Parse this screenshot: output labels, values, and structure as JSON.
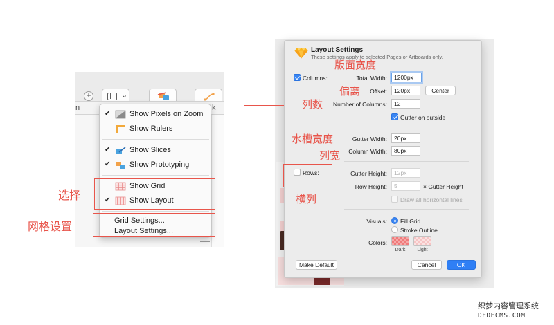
{
  "view_menu": {
    "items": [
      {
        "label": "Show Pixels on Zoom",
        "checked": true,
        "icon": "pixel-zoom-icon"
      },
      {
        "label": "Show Rulers",
        "checked": false,
        "icon": "ruler-icon"
      },
      {
        "label": "Show Slices",
        "checked": true,
        "icon": "slices-icon"
      },
      {
        "label": "Show Prototyping",
        "checked": true,
        "icon": "prototyping-icon"
      },
      {
        "label": "Show Grid",
        "checked": false,
        "icon": "grid-icon"
      },
      {
        "label": "Show Layout",
        "checked": true,
        "icon": "layout-columns-icon"
      },
      {
        "label": "Grid Settings...",
        "checked": false,
        "icon": ""
      },
      {
        "label": "Layout Settings...",
        "checked": false,
        "icon": ""
      }
    ],
    "check_glyph": "✔"
  },
  "toolbar": {
    "plus_glyph": "+",
    "chevron_glyph": "⌄",
    "ruler_left_glyph": "n",
    "ruler_right_glyph": "k"
  },
  "dialog": {
    "title": "Layout Settings",
    "subtitle": "These settings apply to selected Pages or Artboards only.",
    "columns_label": "Columns:",
    "columns_checked": true,
    "total_width_label": "Total Width:",
    "total_width_value": "1200px",
    "offset_label": "Offset:",
    "offset_value": "120px",
    "center_button": "Center",
    "number_of_columns_label": "Number of Columns:",
    "number_of_columns_value": "12",
    "gutter_on_outside_label": "Gutter on outside",
    "gutter_on_outside_checked": true,
    "gutter_width_label": "Gutter Width:",
    "gutter_width_value": "20px",
    "column_width_label": "Column Width:",
    "column_width_value": "80px",
    "rows_label": "Rows:",
    "rows_checked": false,
    "gutter_height_label": "Gutter Height:",
    "gutter_height_value": "12px",
    "row_height_label": "Row Height:",
    "row_height_value": "5",
    "row_height_suffix": "× Gutter Height",
    "draw_all_horizontal_label": "Draw all horizontal lines",
    "visuals_label": "Visuals:",
    "fill_grid_label": "Fill Grid",
    "stroke_outline_label": "Stroke Outline",
    "visuals_selected": "Fill Grid",
    "colors_label": "Colors:",
    "dark_label": "Dark",
    "light_label": "Light",
    "dark_color": "#f07a7a",
    "light_color": "#f6c4c4",
    "make_default_button": "Make Default",
    "cancel_button": "Cancel",
    "ok_button": "OK",
    "accent_color": "#2f7ff5"
  },
  "annotations": {
    "layout_width": "版面宽度",
    "offset": "偏离",
    "columns": "列数",
    "gutter_width": "水槽宽度",
    "column_width": "列宽",
    "rows": "横列",
    "select": "选择",
    "grid_settings": "网格设置",
    "color": "#e8554b"
  },
  "watermark": {
    "cn": "织梦内容管理系统",
    "en": "DEDECMS.COM"
  }
}
